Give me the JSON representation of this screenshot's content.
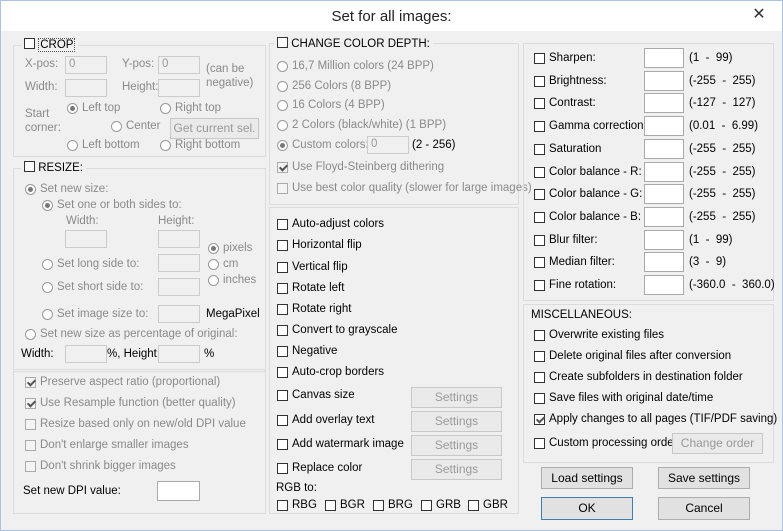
{
  "window": {
    "title": "Set for all images:",
    "close": "✕"
  },
  "crop": {
    "title": "CROP",
    "xpos_label": "X-pos:",
    "xpos_value": "0",
    "ypos_label": "Y-pos:",
    "ypos_value": "0",
    "can_be": "(can be",
    "negative": "negative)",
    "width_label": "Width:",
    "height_label": "Height:",
    "start": "Start",
    "corner": "corner:",
    "left_top": "Left top",
    "right_top": "Right top",
    "center": "Center",
    "get_current": "Get current sel.",
    "left_bottom": "Left bottom",
    "right_bottom": "Right bottom"
  },
  "resize": {
    "title": "RESIZE:",
    "set_new_size": "Set new size:",
    "set_one_or_both": "Set one or both sides to:",
    "width": "Width:",
    "height": "Height:",
    "pixels": "pixels",
    "cm": "cm",
    "inches": "inches",
    "long_side": "Set long side to:",
    "short_side": "Set short side to:",
    "image_size": "Set image size to:",
    "megapixel": "MegaPixel",
    "percentage": "Set new size as percentage of original:",
    "pct_width": "Width:",
    "pct_height": "%, Height:",
    "pct_sign": "%",
    "preserve": "Preserve aspect ratio (proportional)",
    "resample": "Use Resample function (better quality)",
    "dpi_based": "Resize based only on new/old DPI value",
    "dont_enlarge": "Don't enlarge smaller images",
    "dont_shrink": "Don't shrink bigger images",
    "set_dpi": "Set new DPI value:"
  },
  "depth": {
    "title": "CHANGE COLOR DEPTH:",
    "c24": "16,7 Million colors (24 BPP)",
    "c8": "256 Colors (8 BPP)",
    "c4": "16 Colors (4 BPP)",
    "c1": "2 Colors (black/white) (1 BPP)",
    "custom": "Custom colors:",
    "custom_value": "0",
    "custom_range": "(2 - 256)",
    "floyd": "Use Floyd-Steinberg dithering",
    "best_quality": "Use best color quality (slower for large images)"
  },
  "ops": {
    "auto_adjust": "Auto-adjust colors",
    "hflip": "Horizontal flip",
    "vflip": "Vertical flip",
    "rot_left": "Rotate left",
    "rot_right": "Rotate right",
    "grayscale": "Convert to grayscale",
    "negative": "Negative",
    "autocrop": "Auto-crop borders",
    "canvas": "Canvas size",
    "overlay": "Add overlay text",
    "watermark": "Add watermark image",
    "replace": "Replace color",
    "settings": "Settings",
    "rgb_to": "RGB to:",
    "rbg": "RBG",
    "bgr": "BGR",
    "brg": "BRG",
    "grb": "GRB",
    "gbr": "GBR"
  },
  "adjust": [
    {
      "label": "Sharpen:",
      "range": "(1  -  99)"
    },
    {
      "label": "Brightness:",
      "range": "(-255  -  255)"
    },
    {
      "label": "Contrast:",
      "range": "(-127  -  127)"
    },
    {
      "label": "Gamma correction:",
      "range": "(0.01  -  6.99)"
    },
    {
      "label": "Saturation",
      "range": "(-255  -  255)"
    },
    {
      "label": "Color balance - R:",
      "range": "(-255  -  255)"
    },
    {
      "label": "Color balance - G:",
      "range": "(-255  -  255)"
    },
    {
      "label": "Color balance - B:",
      "range": "(-255  -  255)"
    },
    {
      "label": "Blur filter:",
      "range": "(1  -  99)"
    },
    {
      "label": "Median filter:",
      "range": "(3  -  9)"
    },
    {
      "label": "Fine rotation:",
      "range": "(-360.0  -  360.0)"
    }
  ],
  "misc": {
    "title": "MISCELLANEOUS:",
    "overwrite": "Overwrite existing files",
    "delete_orig": "Delete original files after conversion",
    "subfolders": "Create subfolders in destination folder",
    "save_date": "Save files with original date/time",
    "apply_all": "Apply changes to all pages (TIF/PDF saving)",
    "custom_order": "Custom processing order",
    "change_order": "Change order"
  },
  "buttons": {
    "load": "Load settings",
    "save": "Save settings",
    "ok": "OK",
    "cancel": "Cancel"
  }
}
